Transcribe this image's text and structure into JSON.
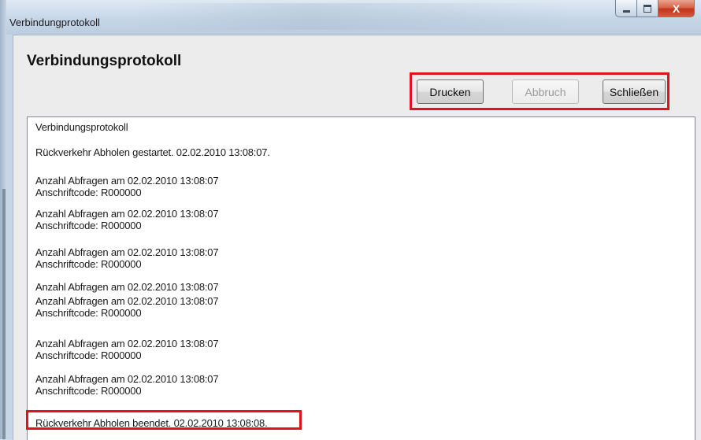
{
  "window": {
    "title": "Verbindungprotokoll",
    "controls": {
      "minimize_icon": "minimize-icon",
      "maximize_icon": "maximize-icon",
      "close_label": "X"
    }
  },
  "dialog": {
    "heading": "Verbindungsprotokoll",
    "buttons": {
      "print": "Drucken",
      "cancel": "Abbruch",
      "close": "Schließen"
    }
  },
  "log": {
    "lines": [
      "Verbindungsprotokoll",
      "Rückverkehr Abholen gestartet. 02.02.2010 13:08:07.",
      "Anzahl Abfragen am 02.02.2010 13:08:07",
      "Anschriftcode: R000000",
      "Anzahl Abfragen am 02.02.2010 13:08:07",
      "Anschriftcode: R000000",
      "Anzahl Abfragen am 02.02.2010 13:08:07",
      "Anschriftcode: R000000",
      "Anzahl Abfragen am 02.02.2010 13:08:07",
      "Anzahl Abfragen am 02.02.2010 13:08:07",
      "Anschriftcode: R000000",
      "Anzahl Abfragen am 02.02.2010 13:08:07",
      "Anschriftcode: R000000",
      "Anzahl Abfragen am 02.02.2010 13:08:07",
      "Anschriftcode: R000000",
      "Rückverkehr Abholen beendet. 02.02.2010 13:08:08."
    ]
  },
  "colors": {
    "highlight": "#e0121e",
    "close_button": "#c2341c"
  }
}
